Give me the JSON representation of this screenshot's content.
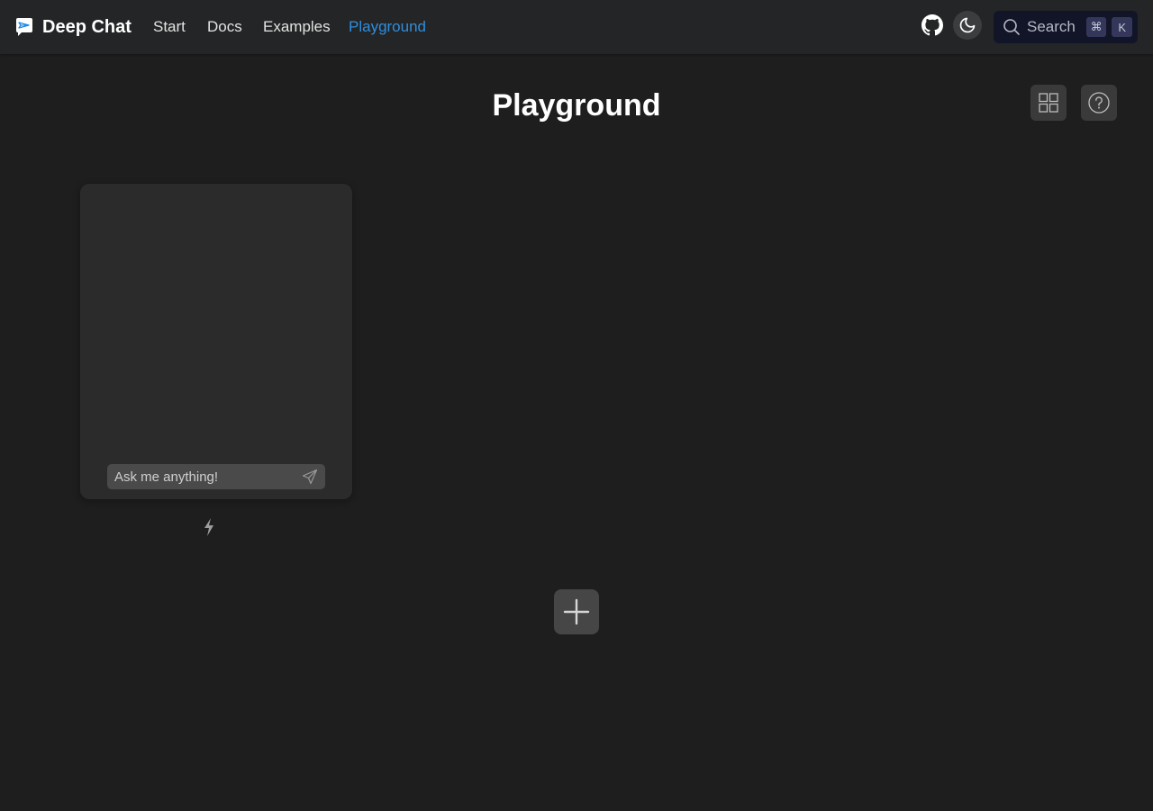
{
  "navbar": {
    "brand_title": "Deep Chat",
    "links": [
      {
        "label": "Start"
      },
      {
        "label": "Docs"
      },
      {
        "label": "Examples"
      },
      {
        "label": "Playground",
        "active": true
      }
    ],
    "active_color": "#2f8ede",
    "search": {
      "label": "Search",
      "shortcut_keys": [
        "⌘",
        "K"
      ]
    },
    "icons": [
      "deep-chat-logo",
      "github-icon",
      "moon-icon",
      "search-icon"
    ]
  },
  "page": {
    "title": "Playground",
    "tool_icons": [
      "grid-icon",
      "help-icon"
    ]
  },
  "chat": {
    "input_placeholder": "Ask me anything!",
    "icons": [
      "send-icon",
      "lightning-icon"
    ]
  },
  "actions": {
    "add_icon": "plus-icon"
  }
}
